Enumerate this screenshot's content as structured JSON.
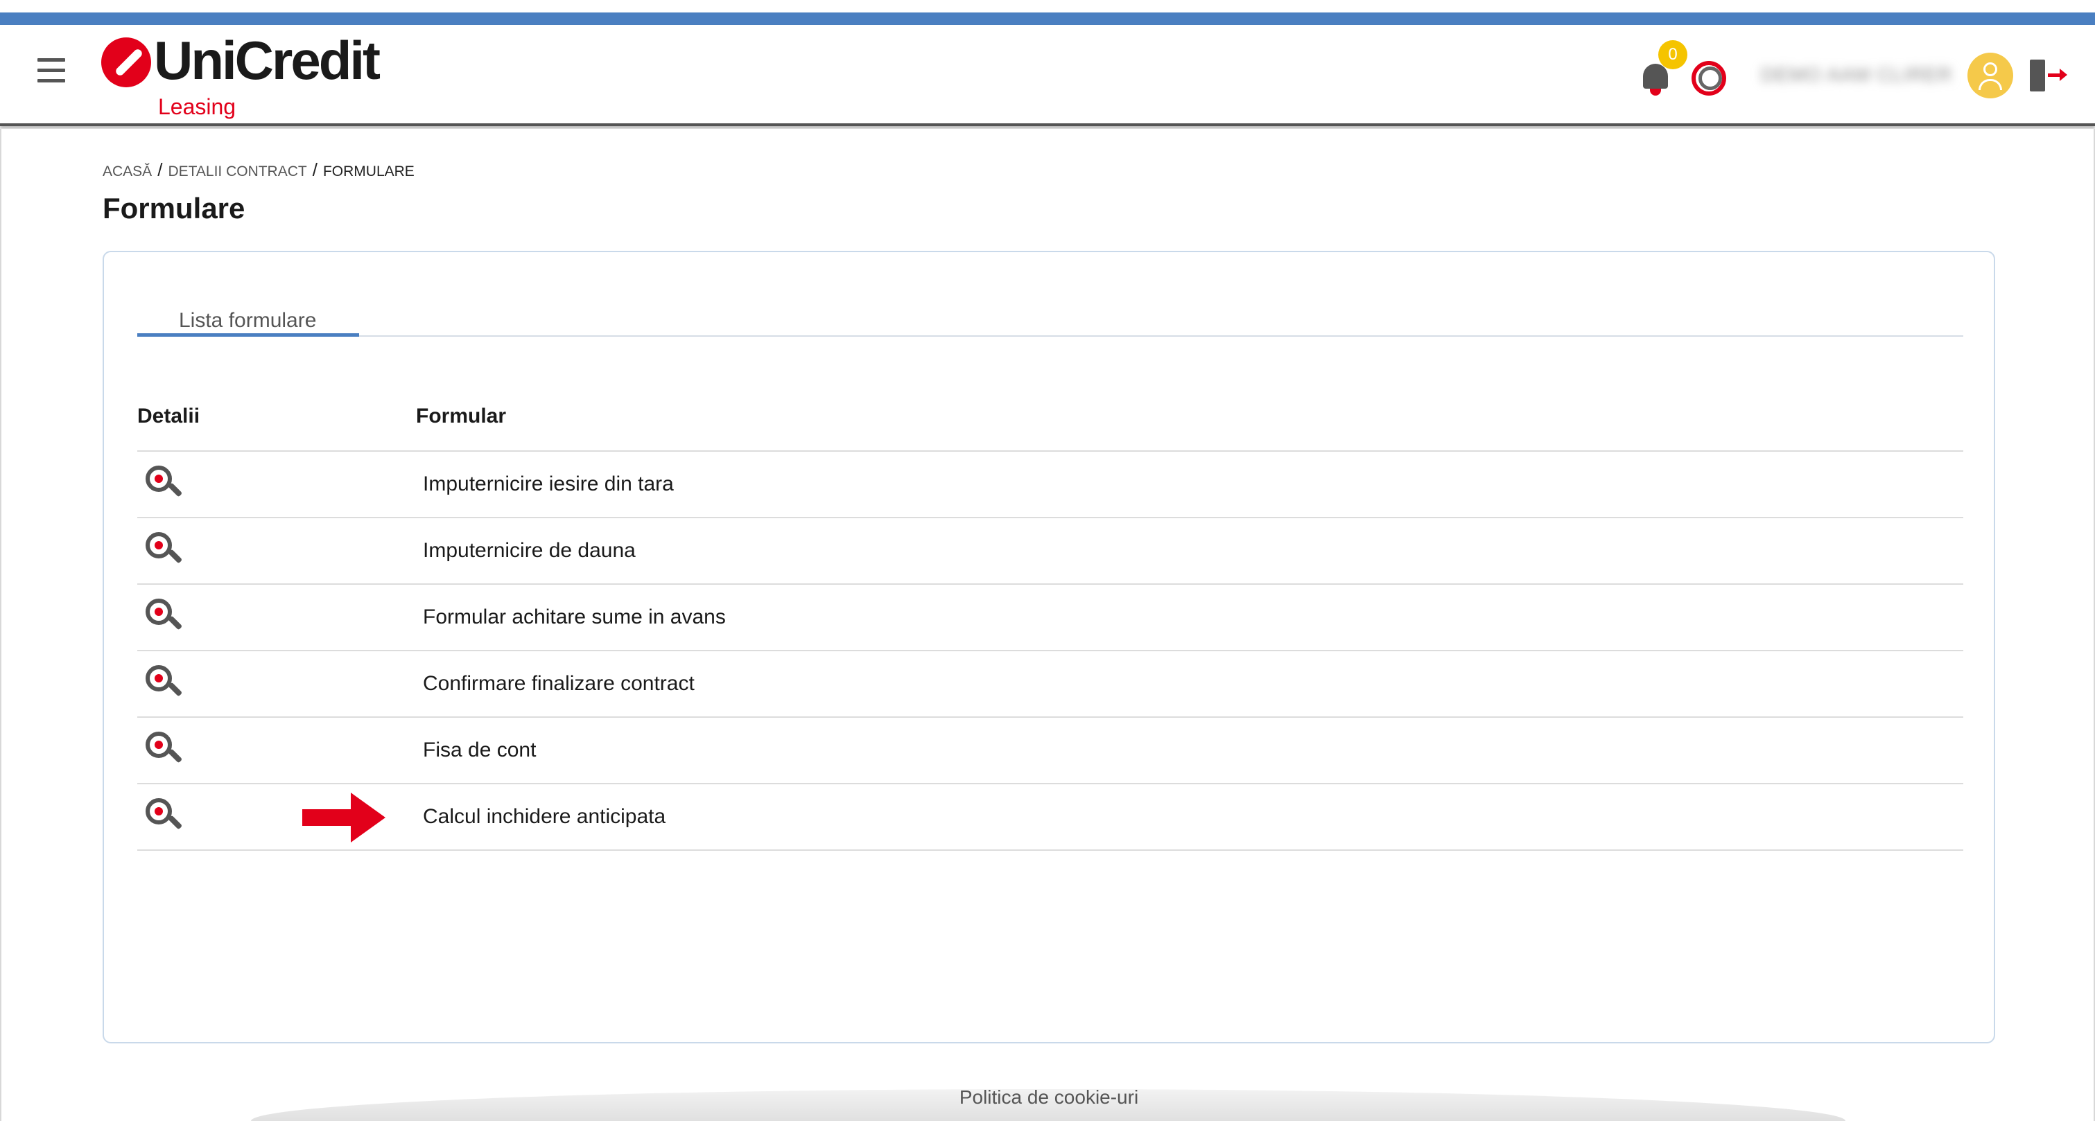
{
  "header": {
    "logo_text": "UniCredit",
    "logo_sub": "Leasing",
    "notifications_count": "0",
    "username": "DEMO AAM CLIRER"
  },
  "breadcrumb": {
    "items": [
      "ACASĂ",
      "DETALII CONTRACT",
      "FORMULARE"
    ],
    "separator": "/"
  },
  "page": {
    "title": "Formulare"
  },
  "tabs": [
    {
      "label": "Lista formulare",
      "active": true
    }
  ],
  "table": {
    "headers": {
      "detalii": "Detalii",
      "formular": "Formular"
    },
    "rows": [
      {
        "formular": "Imputernicire iesire din tara"
      },
      {
        "formular": "Imputernicire de dauna"
      },
      {
        "formular": "Formular achitare sume in avans"
      },
      {
        "formular": "Confirmare finalizare contract"
      },
      {
        "formular": "Fisa de cont"
      },
      {
        "formular": "Calcul inchidere anticipata",
        "highlighted": true
      }
    ]
  },
  "footer": {
    "cookie_link": "Politica de cookie-uri"
  },
  "colors": {
    "accent_blue": "#4a7fc1",
    "brand_red": "#e2001a",
    "badge_yellow": "#f5c400",
    "avatar_yellow": "#f5c94a"
  },
  "icons": {
    "menu": "hamburger-icon",
    "notifications": "bell-icon",
    "language": "globe-icon",
    "profile": "user-icon",
    "logout": "logout-icon",
    "row_action": "zoom-icon",
    "annotation": "red-arrow"
  }
}
